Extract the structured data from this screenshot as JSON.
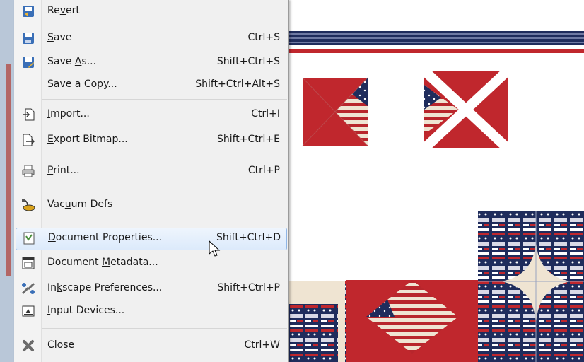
{
  "menu": {
    "items": [
      {
        "id": "revert",
        "pre": "Re",
        "u": "v",
        "post": "ert",
        "shortcut": "",
        "icon": "revert-icon"
      },
      {
        "id": "save",
        "pre": "",
        "u": "S",
        "post": "ave",
        "shortcut": "Ctrl+S",
        "icon": "save-icon"
      },
      {
        "id": "save-as",
        "pre": "Save ",
        "u": "A",
        "post": "s...",
        "shortcut": "Shift+Ctrl+S",
        "icon": "save-as-icon"
      },
      {
        "id": "save-copy",
        "pre": "Save a Copy...",
        "u": "",
        "post": "",
        "shortcut": "Shift+Ctrl+Alt+S",
        "icon": ""
      },
      {
        "id": "import",
        "pre": "",
        "u": "I",
        "post": "mport...",
        "shortcut": "Ctrl+I",
        "icon": "import-icon"
      },
      {
        "id": "export-bitmap",
        "pre": "",
        "u": "E",
        "post": "xport Bitmap...",
        "shortcut": "Shift+Ctrl+E",
        "icon": "export-icon"
      },
      {
        "id": "print",
        "pre": "",
        "u": "P",
        "post": "rint...",
        "shortcut": "Ctrl+P",
        "icon": "printer-icon"
      },
      {
        "id": "vacuum-defs",
        "pre": "Vac",
        "u": "u",
        "post": "um Defs",
        "shortcut": "",
        "icon": "vacuum-icon"
      },
      {
        "id": "document-properties",
        "pre": "",
        "u": "D",
        "post": "ocument Properties...",
        "shortcut": "Shift+Ctrl+D",
        "icon": "document-properties-icon"
      },
      {
        "id": "document-metadata",
        "pre": "Document ",
        "u": "M",
        "post": "etadata...",
        "shortcut": "",
        "icon": "document-metadata-icon"
      },
      {
        "id": "inkscape-preferences",
        "pre": "In",
        "u": "k",
        "post": "scape Preferences...",
        "shortcut": "Shift+Ctrl+P",
        "icon": "preferences-icon"
      },
      {
        "id": "input-devices",
        "pre": "",
        "u": "I",
        "post": "nput Devices...",
        "shortcut": "",
        "icon": "input-devices-icon"
      },
      {
        "id": "close",
        "pre": "",
        "u": "C",
        "post": "lose",
        "shortcut": "Ctrl+W",
        "icon": "close-icon"
      }
    ]
  },
  "colors": {
    "menu_bg": "#f0f0f0",
    "highlight_border": "#8fb5e5",
    "quilt_red": "#c0272d",
    "quilt_navy": "#1f2c5c",
    "quilt_cream": "#efe4d2"
  }
}
